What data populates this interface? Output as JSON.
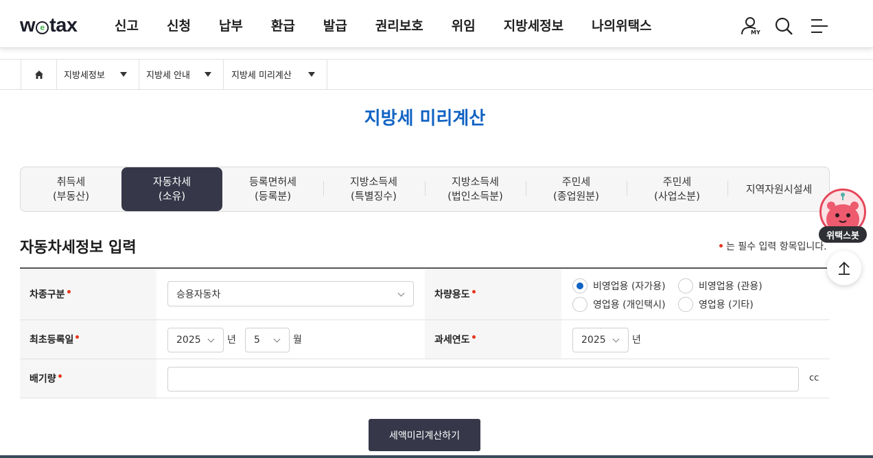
{
  "header": {
    "logo": {
      "before": "w",
      "mid": "e",
      "after": "tax"
    },
    "nav": [
      "신고",
      "신청",
      "납부",
      "환급",
      "발급",
      "권리보호",
      "위임",
      "지방세정보",
      "나의위택스"
    ],
    "my_tag": "MY",
    "icons": [
      "my-user-icon",
      "search-icon",
      "menu-icon"
    ]
  },
  "breadcrumb": {
    "items": [
      "지방세정보",
      "지방세 안내",
      "지방세 미리계산"
    ]
  },
  "page_title": "지방세 미리계산",
  "tabs": [
    {
      "line1": "취득세",
      "line2": "(부동산)"
    },
    {
      "line1": "자동차세",
      "line2": "(소유)"
    },
    {
      "line1": "등록면허세",
      "line2": "(등록분)"
    },
    {
      "line1": "지방소득세",
      "line2": "(특별징수)"
    },
    {
      "line1": "지방소득세",
      "line2": "(법인소득분)"
    },
    {
      "line1": "주민세",
      "line2": "(종업원분)"
    },
    {
      "line1": "주민세",
      "line2": "(사업소분)"
    },
    {
      "line1": "지역자원시설세",
      "line2": ""
    }
  ],
  "active_tab_index": 1,
  "section": {
    "title": "자동차세정보 입력",
    "required_note": "는 필수 입력 항목입니다."
  },
  "form": {
    "car_type": {
      "label": "차종구분",
      "value": "승용자동차"
    },
    "car_use": {
      "label": "차량용도",
      "options": [
        "비영업용 (자가용)",
        "비영업용 (관용)",
        "영업용 (개인택시)",
        "영업용 (기타)"
      ],
      "selected": "비영업용 (자가용)"
    },
    "first_reg": {
      "label": "최초등록일",
      "year": "2025",
      "year_unit": "년",
      "month": "5",
      "month_unit": "월"
    },
    "tax_year": {
      "label": "과세연도",
      "year": "2025",
      "year_unit": "년"
    },
    "displacement": {
      "label": "배기량",
      "value": "",
      "unit": "cc"
    }
  },
  "submit_label": "세액미리계산하기",
  "chatbot_label": "위택스봇",
  "colors": {
    "accent": "#1163c4",
    "dark": "#363849",
    "required": "#e8361d",
    "chatbot": "#e6465a"
  }
}
